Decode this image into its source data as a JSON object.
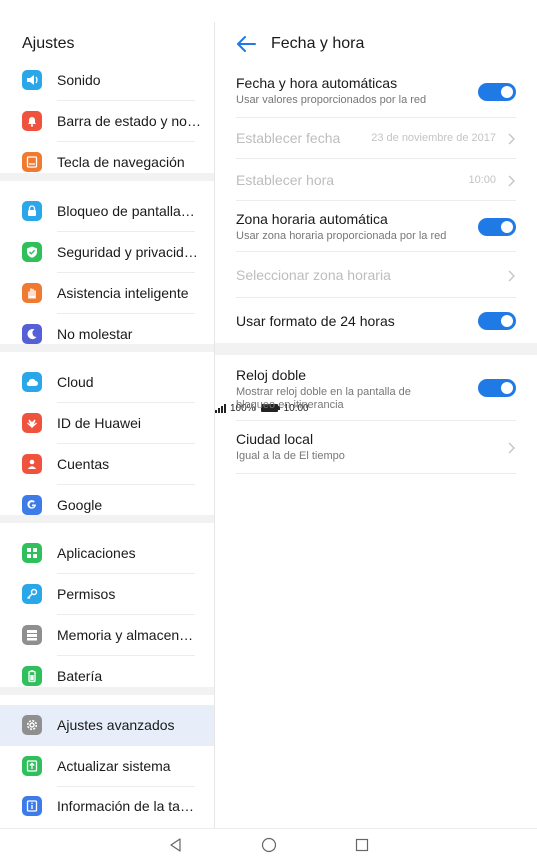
{
  "status_bar": {
    "battery_label": "100%",
    "time": "10:00"
  },
  "sidebar": {
    "title": "Ajustes",
    "items": [
      {
        "label": "Sonido",
        "icon": "speaker-icon",
        "color": "#2aa7e8"
      },
      {
        "label": "Barra de estado y no…",
        "icon": "bell-icon",
        "color": "#f0533d"
      },
      {
        "label": "Tecla de navegación",
        "icon": "navigation-key-icon",
        "color": "#f07a30"
      },
      {
        "label": "Bloqueo de pantalla…",
        "icon": "lock-icon",
        "color": "#2aa7e8"
      },
      {
        "label": "Seguridad y privacid…",
        "icon": "shield-icon",
        "color": "#2fbf5b"
      },
      {
        "label": "Asistencia inteligente",
        "icon": "hand-icon",
        "color": "#f07a30"
      },
      {
        "label": "No molestar",
        "icon": "moon-icon",
        "color": "#5560d6"
      },
      {
        "label": "Cloud",
        "icon": "cloud-icon",
        "color": "#2aa7e8"
      },
      {
        "label": "ID de Huawei",
        "icon": "huawei-icon",
        "color": "#f0533d"
      },
      {
        "label": "Cuentas",
        "icon": "person-icon",
        "color": "#f0533d"
      },
      {
        "label": "Google",
        "icon": "google-icon",
        "color": "#3d7ce8"
      },
      {
        "label": "Aplicaciones",
        "icon": "apps-grid-icon",
        "color": "#2fbf5b"
      },
      {
        "label": "Permisos",
        "icon": "key-icon",
        "color": "#2aa7e8"
      },
      {
        "label": "Memoria y almacen…",
        "icon": "storage-icon",
        "color": "#8f8f8f"
      },
      {
        "label": "Batería",
        "icon": "battery-icon",
        "color": "#2fbf5b"
      },
      {
        "label": "Ajustes avanzados",
        "icon": "gear-icon",
        "color": "#8f8f8f"
      },
      {
        "label": "Actualizar sistema",
        "icon": "update-icon",
        "color": "#2fbf5b"
      },
      {
        "label": "Información de la ta…",
        "icon": "info-icon",
        "color": "#3d7ce8"
      }
    ]
  },
  "detail": {
    "title": "Fecha y hora",
    "auto_datetime": {
      "title": "Fecha y hora automáticas",
      "subtitle": "Usar valores proporcionados por la red",
      "enabled": true
    },
    "set_date": {
      "title": "Establecer fecha",
      "value": "23 de noviembre de 2017"
    },
    "set_time": {
      "title": "Establecer hora",
      "value": "10:00"
    },
    "auto_timezone": {
      "title": "Zona horaria automática",
      "subtitle": "Usar zona horaria proporcionada por la red",
      "enabled": true
    },
    "select_timezone": {
      "title": "Seleccionar zona horaria"
    },
    "format_24h": {
      "title": "Usar formato de 24 horas",
      "enabled": true
    },
    "dual_clock": {
      "title": "Reloj doble",
      "subtitle": "Mostrar reloj doble en la pantalla de bloqueo en itinerancia",
      "enabled": true
    },
    "home_city": {
      "title": "Ciudad local",
      "subtitle": "Igual a la de El tiempo"
    }
  },
  "accent_color": "#1f7ae6"
}
